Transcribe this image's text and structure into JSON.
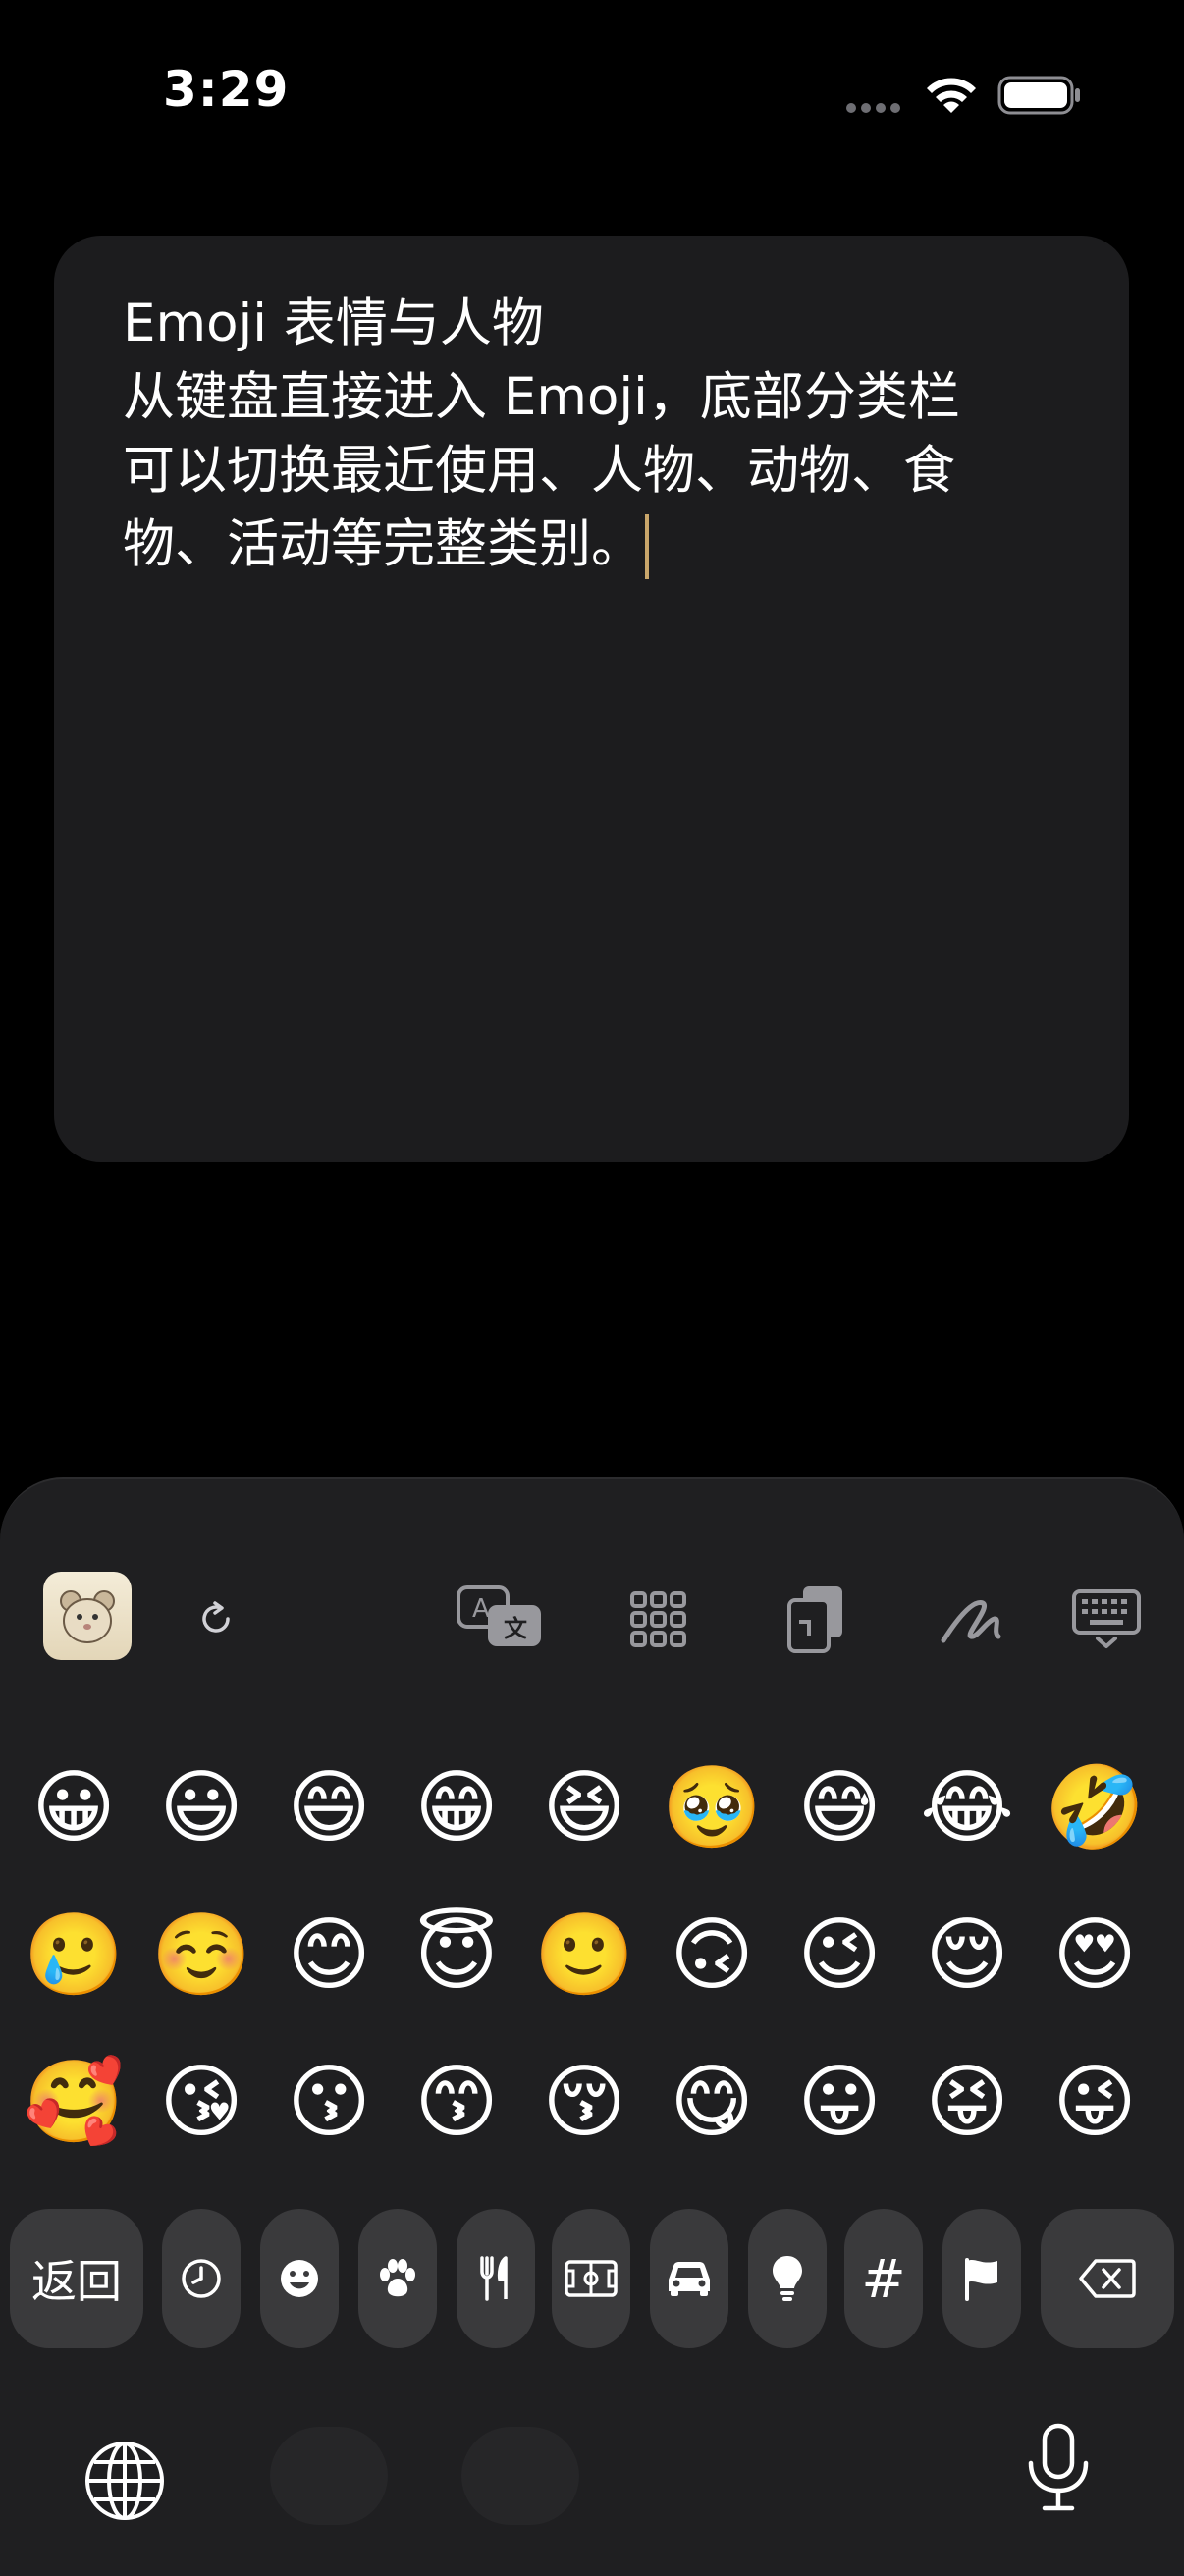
{
  "status_bar": {
    "time": "3:29"
  },
  "note": {
    "lines": [
      "Emoji 表情与人物",
      "从键盘直接进入 Emoji，底部分类栏",
      "可以切换最近使用、人物、动物、食",
      "物、活动等完整类别。"
    ]
  },
  "toolbar": {
    "items": [
      "app-icon",
      "refresh-icon",
      "translate-icon",
      "grid-apps-icon",
      "clipboard-icon",
      "handwriting-icon",
      "keyboard-hide-icon"
    ]
  },
  "emoji_rows": [
    [
      "😀",
      "😃",
      "😄",
      "😁",
      "😆",
      "🥹",
      "😅",
      "😂",
      "🤣"
    ],
    [
      "🥲",
      "☺️",
      "😊",
      "😇",
      "🙂",
      "🙃",
      "😉",
      "😌",
      "😍"
    ],
    [
      "🥰",
      "😘",
      "😗",
      "😙",
      "😚",
      "😋",
      "😛",
      "😝",
      "😜"
    ]
  ],
  "category_bar": {
    "return_label": "返回",
    "categories": [
      "recent-clock-icon",
      "smiley-icon",
      "animal-paw-icon",
      "food-utensils-icon",
      "activity-field-icon",
      "travel-car-icon",
      "objects-bulb-icon",
      "symbols-hash-icon",
      "flags-icon"
    ],
    "hash_glyph": "#"
  },
  "bottom": {
    "left": "globe-icon",
    "right": "microphone-icon"
  }
}
